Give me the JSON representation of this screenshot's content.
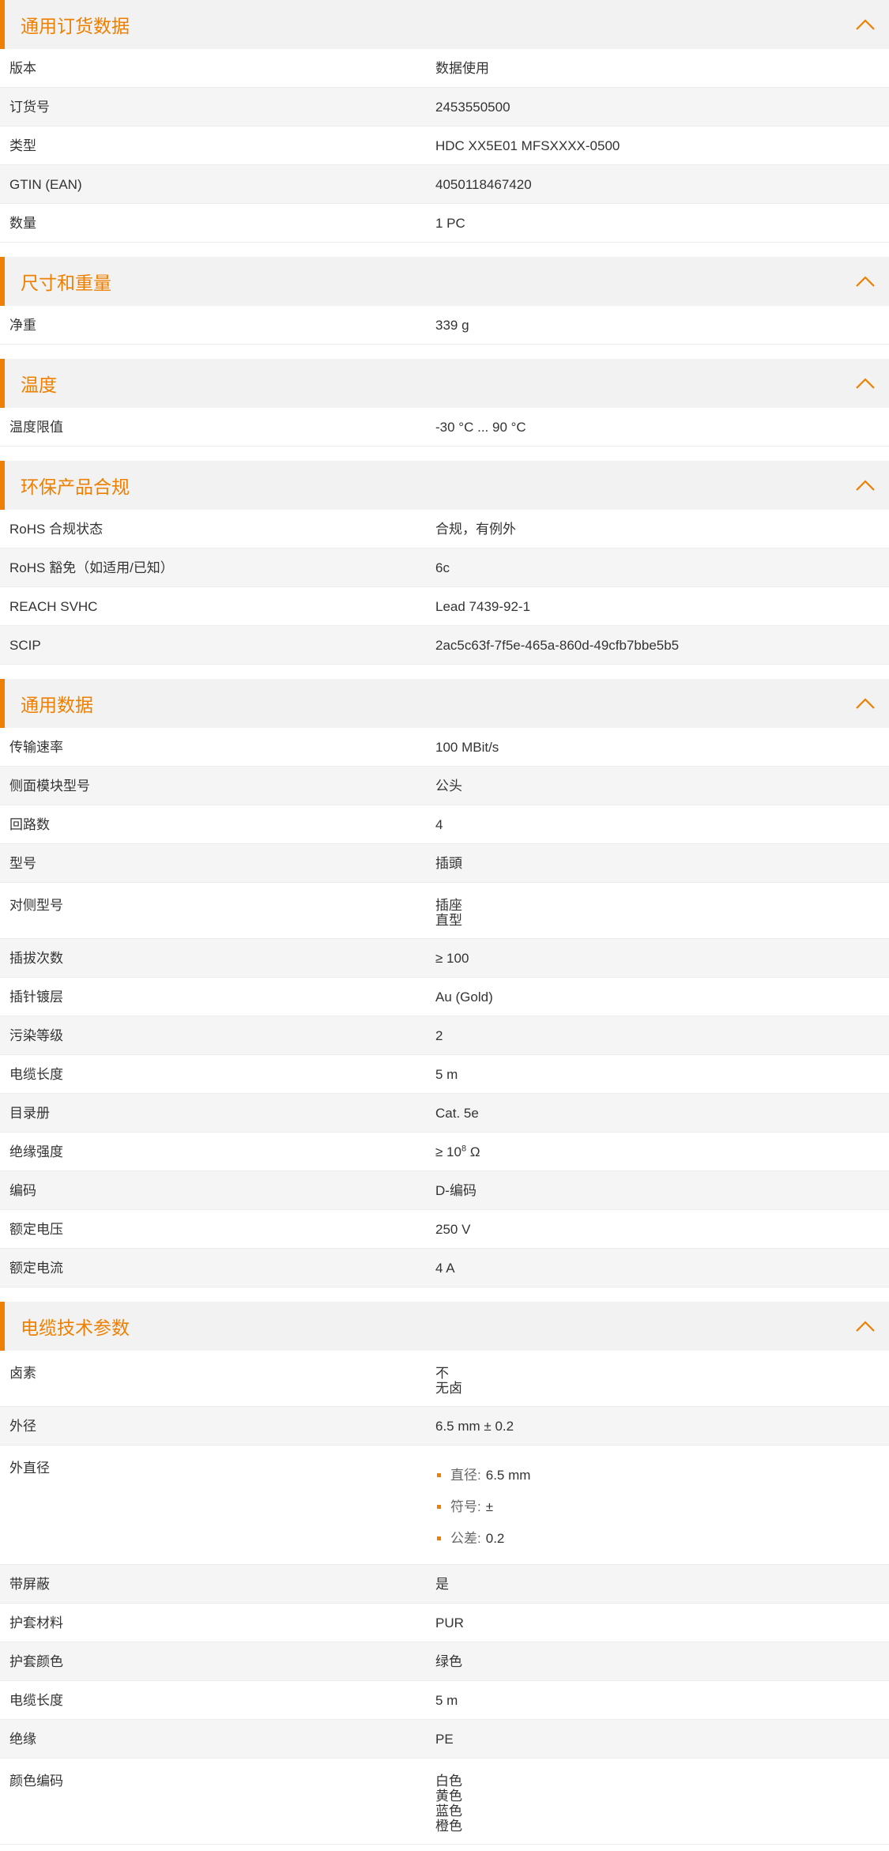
{
  "accent_color": "#ee7f00",
  "sections": [
    {
      "title": "通用订货数据",
      "rows": [
        {
          "key": "版本",
          "value": "数据使用"
        },
        {
          "key": "订货号",
          "value": "2453550500"
        },
        {
          "key": "类型",
          "value": "HDC XX5E01 MFSXXXX-0500"
        },
        {
          "key": "GTIN (EAN)",
          "value": "4050118467420"
        },
        {
          "key": "数量",
          "value": "1  PC"
        }
      ]
    },
    {
      "title": "尺寸和重量",
      "rows": [
        {
          "key": "净重",
          "value": "339  g"
        }
      ]
    },
    {
      "title": "温度",
      "rows": [
        {
          "key": "温度限值",
          "value": "-30 °C ... 90 °C"
        }
      ]
    },
    {
      "title": "环保产品合规",
      "rows": [
        {
          "key": "RoHS 合规状态",
          "value": "合规，有例外"
        },
        {
          "key": "RoHS 豁免（如适用/已知）",
          "value": "6c"
        },
        {
          "key": "REACH SVHC",
          "value": "Lead 7439-92-1"
        },
        {
          "key": "SCIP",
          "value": "2ac5c63f-7f5e-465a-860d-49cfb7bbe5b5"
        }
      ]
    },
    {
      "title": "通用数据",
      "rows": [
        {
          "key": "传输速率",
          "value": "100 MBit/s"
        },
        {
          "key": "侧面模块型号",
          "value": "公头"
        },
        {
          "key": "回路数",
          "value": "4"
        },
        {
          "key": "型号",
          "value": "插頭"
        },
        {
          "key": "对侧型号",
          "lines": [
            "插座",
            "直型"
          ]
        },
        {
          "key": "插拔次数",
          "value": "≥ 100"
        },
        {
          "key": "插针镀层",
          "value": "Au (Gold)"
        },
        {
          "key": "污染等级",
          "value": "2"
        },
        {
          "key": "电缆长度",
          "value": "5  m"
        },
        {
          "key": "目录册",
          "value": "Cat. 5e"
        },
        {
          "key": "绝缘强度",
          "value": "≥ 10",
          "sup": "8",
          "suffix": " Ω"
        },
        {
          "key": "编码",
          "value": "D-编码"
        },
        {
          "key": "额定电压",
          "value": "250  V"
        },
        {
          "key": "额定电流",
          "value": "4  A"
        }
      ]
    },
    {
      "title": "电缆技术参数",
      "rows": [
        {
          "key": "卤素",
          "lines": [
            "不",
            "无卤"
          ]
        },
        {
          "key": "外径",
          "value": "6.5 mm ± 0.2"
        },
        {
          "key": "外直径",
          "bullets": [
            {
              "label": "直径:",
              "value": "6.5 mm"
            },
            {
              "label": "符号:",
              "value": "±"
            },
            {
              "label": "公差:",
              "value": "0.2"
            }
          ]
        },
        {
          "key": "带屏蔽",
          "value": "是"
        },
        {
          "key": "护套材料",
          "value": "PUR"
        },
        {
          "key": "护套颜色",
          "value": "绿色"
        },
        {
          "key": "电缆长度",
          "value": "5  m"
        },
        {
          "key": "绝缘",
          "value": "PE"
        },
        {
          "key": "颜色编码",
          "lines": [
            "白色",
            "黄色",
            "蓝色",
            "橙色"
          ]
        }
      ]
    }
  ]
}
